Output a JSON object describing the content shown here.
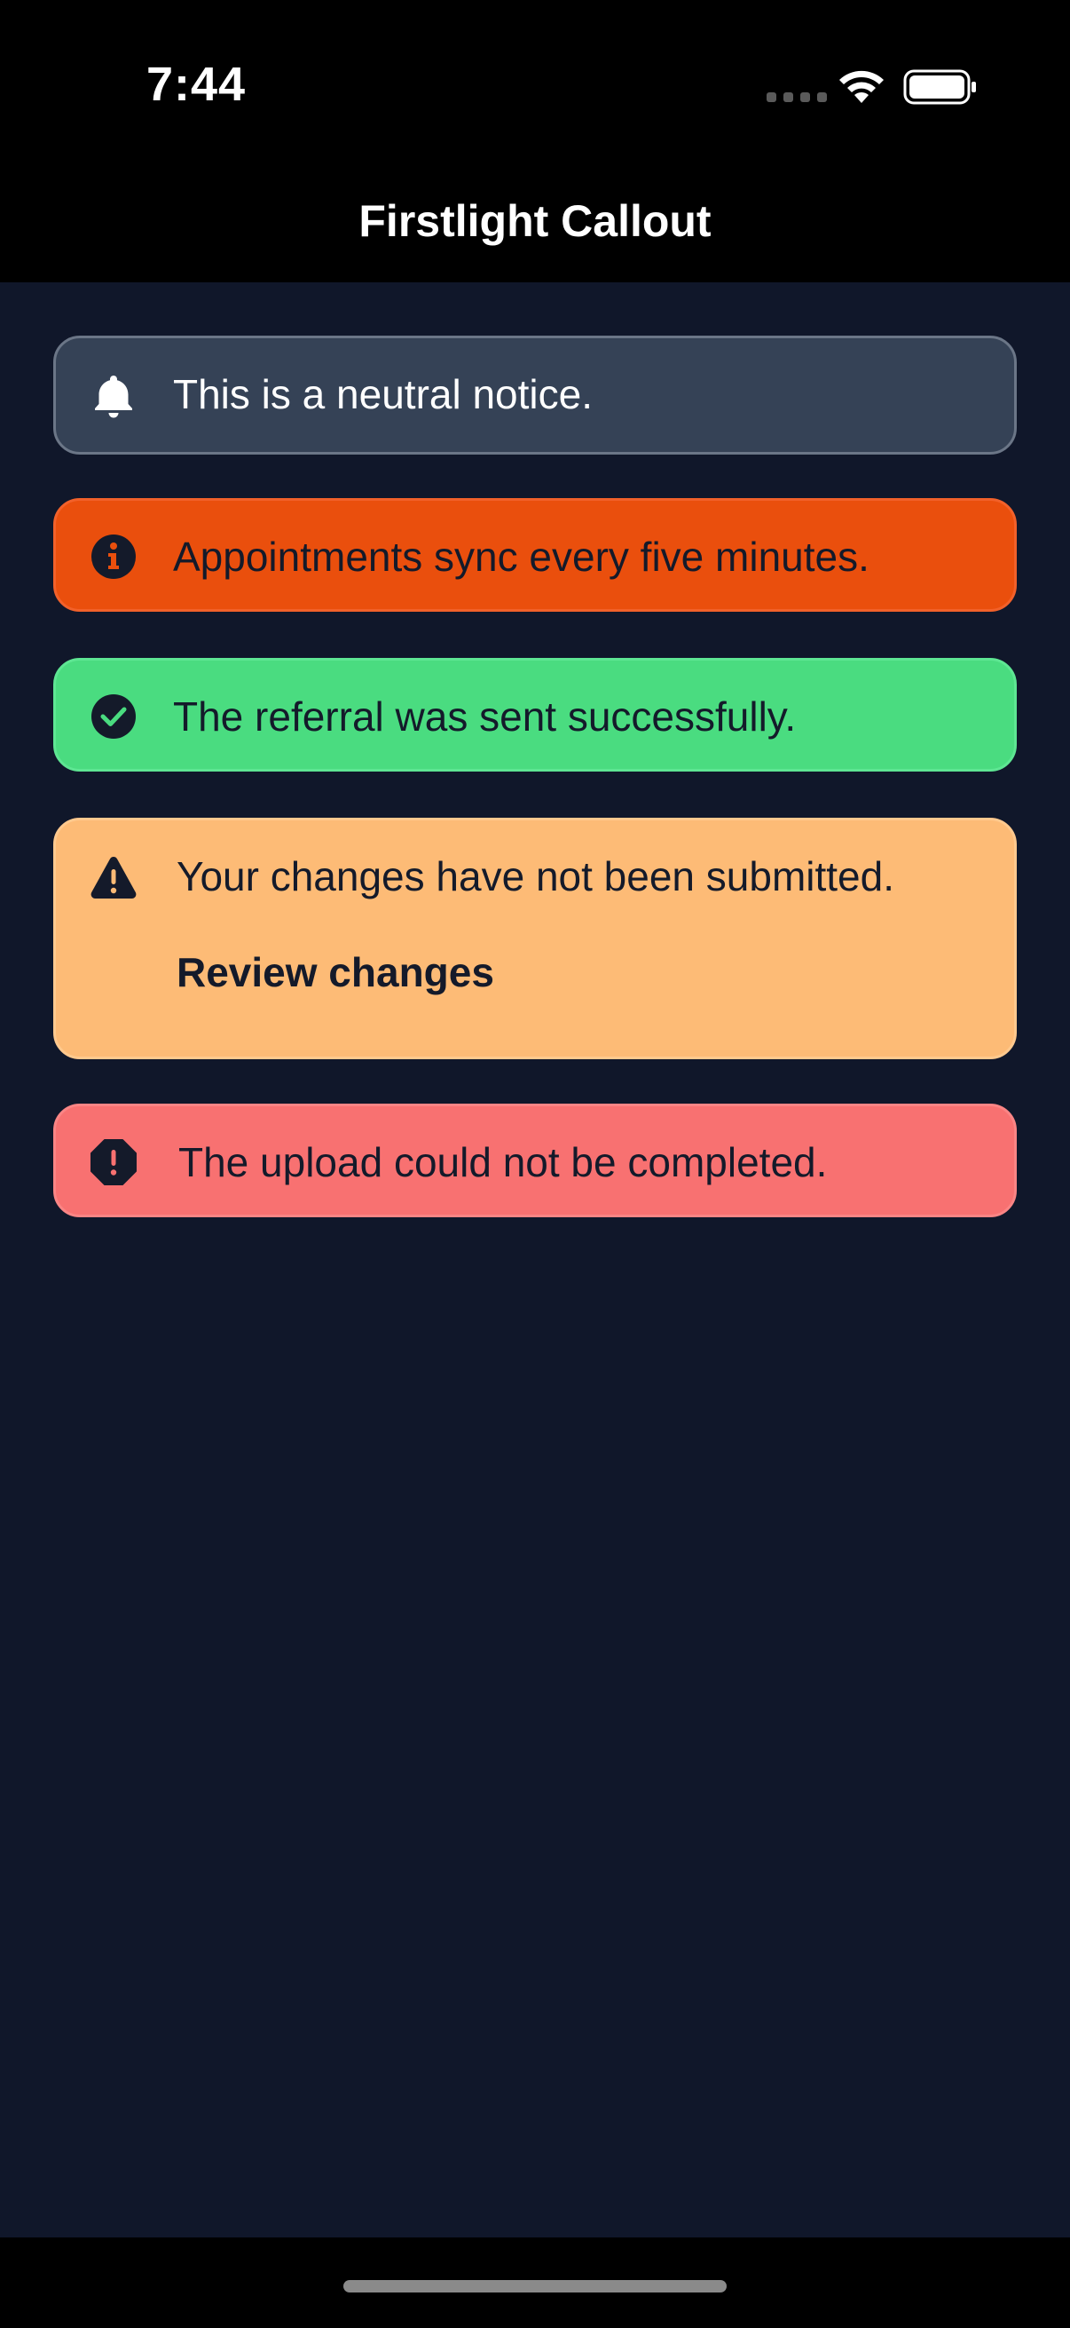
{
  "status_bar": {
    "time": "7:44"
  },
  "nav": {
    "title": "Firstlight Callout"
  },
  "callouts": [
    {
      "variant": "neutral",
      "icon": "bell-icon",
      "message": "This is a neutral notice."
    },
    {
      "variant": "info",
      "icon": "info-icon",
      "message": "Appointments sync every five minutes."
    },
    {
      "variant": "success",
      "icon": "check-circle-icon",
      "message": "The referral was sent successfully."
    },
    {
      "variant": "warning",
      "icon": "warning-triangle-icon",
      "message": "Your changes have not been submitted.",
      "action": "Review changes"
    },
    {
      "variant": "error",
      "icon": "error-octagon-icon",
      "message": "The upload could not be completed."
    }
  ],
  "colors": {
    "background": "#10172a",
    "neutral": "#354256",
    "info": "#ea4f0d",
    "success": "#4adc80",
    "warning": "#fdbb76",
    "error": "#f87171",
    "icon_dark": "#141a2a"
  }
}
